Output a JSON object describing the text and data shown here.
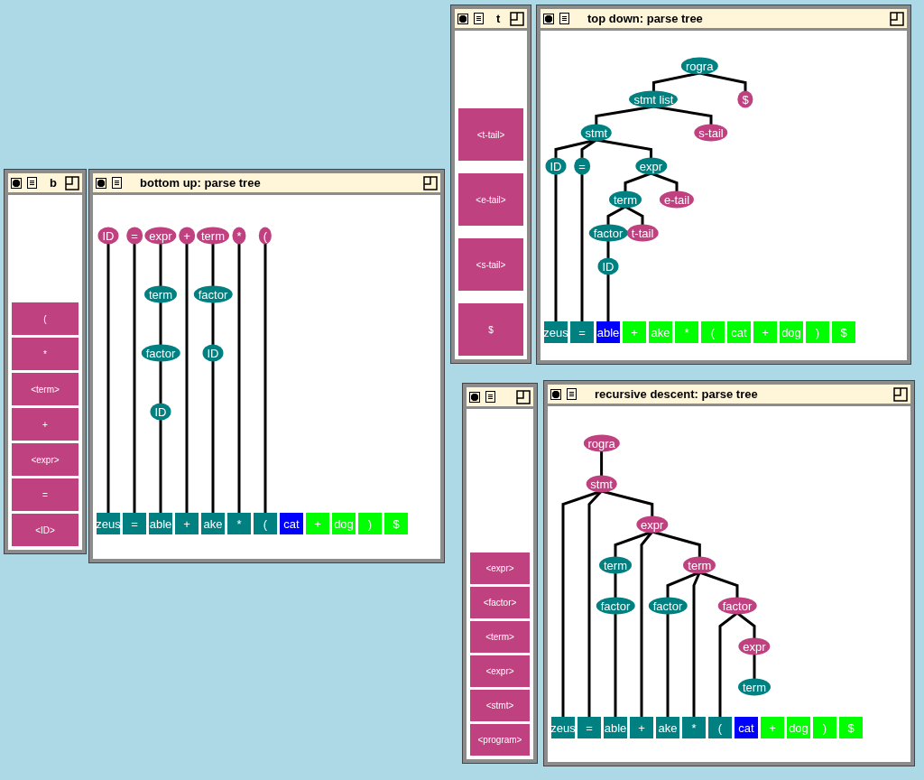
{
  "windows": [
    {
      "stack": {
        "title": "b",
        "items": [
          {
            "label": "("
          },
          {
            "label": "*"
          },
          {
            "label": "<term>"
          },
          {
            "label": "+"
          },
          {
            "label": "<expr>"
          },
          {
            "label": "="
          },
          {
            "label": "<ID>"
          }
        ]
      },
      "tree": {
        "title": "bottom up: parse tree",
        "roots": [
          {
            "kind": "node",
            "label": "ID",
            "color": "#c0417f",
            "children": [
              {
                "kind": "token"
              }
            ]
          },
          {
            "kind": "node",
            "label": "=",
            "color": "#c0417f",
            "children": [
              {
                "kind": "token"
              }
            ]
          },
          {
            "kind": "node",
            "label": "expr",
            "color": "#c0417f",
            "children": [
              {
                "kind": "node",
                "label": "term",
                "color": "#008080",
                "children": [
                  {
                    "kind": "node",
                    "label": "factor",
                    "color": "#008080",
                    "children": [
                      {
                        "kind": "node",
                        "label": "ID",
                        "color": "#008080",
                        "children": [
                          {
                            "kind": "token"
                          }
                        ]
                      }
                    ]
                  }
                ]
              }
            ]
          },
          {
            "kind": "node",
            "label": "+",
            "color": "#c0417f",
            "children": [
              {
                "kind": "token"
              }
            ]
          },
          {
            "kind": "node",
            "label": "term",
            "color": "#c0417f",
            "children": [
              {
                "kind": "node",
                "label": "factor",
                "color": "#008080",
                "children": [
                  {
                    "kind": "node",
                    "label": "ID",
                    "color": "#008080",
                    "children": [
                      {
                        "kind": "token"
                      }
                    ]
                  }
                ]
              }
            ]
          },
          {
            "kind": "node",
            "label": "*",
            "color": "#c0417f",
            "children": [
              {
                "kind": "token"
              }
            ]
          },
          {
            "kind": "node",
            "label": "(",
            "color": "#c0417f",
            "children": [
              {
                "kind": "token"
              }
            ]
          }
        ],
        "tokens": [
          {
            "label": "zeus",
            "color": "#008080"
          },
          {
            "label": "=",
            "color": "#008080"
          },
          {
            "label": "able",
            "color": "#008080"
          },
          {
            "label": "+",
            "color": "#008080"
          },
          {
            "label": "ake",
            "color": "#008080"
          },
          {
            "label": "*",
            "color": "#008080"
          },
          {
            "label": "(",
            "color": "#008080"
          },
          {
            "label": "cat",
            "color": "#0000ff"
          },
          {
            "label": "+",
            "color": "#00ff00"
          },
          {
            "label": "dog",
            "color": "#00ff00"
          },
          {
            "label": ")",
            "color": "#00ff00"
          },
          {
            "label": "$",
            "color": "#00ff00"
          }
        ]
      }
    },
    {
      "stack": {
        "title": "t",
        "items": [
          {
            "label": "<t-tail>"
          },
          {
            "label": "<e-tail>"
          },
          {
            "label": "<s-tail>"
          },
          {
            "label": "$"
          }
        ]
      },
      "tree": {
        "title": "top down: parse tree",
        "roots": [
          {
            "kind": "node",
            "label": "rogra",
            "color": "#008080",
            "children": [
              {
                "kind": "node",
                "label": "stmt list",
                "color": "#008080",
                "children": [
                  {
                    "kind": "node",
                    "label": "stmt",
                    "color": "#008080",
                    "children": [
                      {
                        "kind": "node",
                        "label": "ID",
                        "color": "#008080",
                        "children": [
                          {
                            "kind": "token"
                          }
                        ]
                      },
                      {
                        "kind": "node",
                        "label": "=",
                        "color": "#008080",
                        "children": [
                          {
                            "kind": "token"
                          }
                        ]
                      },
                      {
                        "kind": "node",
                        "label": "expr",
                        "color": "#008080",
                        "children": [
                          {
                            "kind": "node",
                            "label": "term",
                            "color": "#008080",
                            "children": [
                              {
                                "kind": "node",
                                "label": "factor",
                                "color": "#008080",
                                "children": [
                                  {
                                    "kind": "node",
                                    "label": "ID",
                                    "color": "#008080",
                                    "children": [
                                      {
                                        "kind": "token"
                                      }
                                    ]
                                  }
                                ]
                              },
                              {
                                "kind": "node",
                                "label": "t-tail",
                                "color": "#c0417f"
                              }
                            ]
                          },
                          {
                            "kind": "node",
                            "label": "e-tail",
                            "color": "#c0417f"
                          }
                        ]
                      }
                    ]
                  },
                  {
                    "kind": "node",
                    "label": "s-tail",
                    "color": "#c0417f"
                  }
                ]
              },
              {
                "kind": "node",
                "label": "$",
                "color": "#c0417f"
              }
            ]
          }
        ],
        "tokens": [
          {
            "label": "zeus",
            "color": "#008080"
          },
          {
            "label": "=",
            "color": "#008080"
          },
          {
            "label": "able",
            "color": "#0000ff"
          },
          {
            "label": "+",
            "color": "#00ff00"
          },
          {
            "label": "ake",
            "color": "#00ff00"
          },
          {
            "label": "*",
            "color": "#00ff00"
          },
          {
            "label": "(",
            "color": "#00ff00"
          },
          {
            "label": "cat",
            "color": "#00ff00"
          },
          {
            "label": "+",
            "color": "#00ff00"
          },
          {
            "label": "dog",
            "color": "#00ff00"
          },
          {
            "label": ")",
            "color": "#00ff00"
          },
          {
            "label": "$",
            "color": "#00ff00"
          }
        ]
      }
    },
    {
      "stack": {
        "items": [
          {
            "label": "<expr>"
          },
          {
            "label": "<factor>"
          },
          {
            "label": "<term>"
          },
          {
            "label": "<expr>"
          },
          {
            "label": "<stmt>"
          },
          {
            "label": "<program>"
          }
        ]
      },
      "tree": {
        "title": "recursive descent: parse tree",
        "roots": [
          {
            "kind": "node",
            "label": "rogra",
            "color": "#c0417f",
            "children": [
              {
                "kind": "node",
                "label": "stmt",
                "color": "#c0417f",
                "children": [
                  {
                    "kind": "token"
                  },
                  {
                    "kind": "token"
                  },
                  {
                    "kind": "node",
                    "label": "expr",
                    "color": "#c0417f",
                    "children": [
                      {
                        "kind": "node",
                        "label": "term",
                        "color": "#008080",
                        "children": [
                          {
                            "kind": "node",
                            "label": "factor",
                            "color": "#008080",
                            "children": [
                              {
                                "kind": "token"
                              }
                            ]
                          }
                        ]
                      },
                      {
                        "kind": "token"
                      },
                      {
                        "kind": "node",
                        "label": "term",
                        "color": "#c0417f",
                        "children": [
                          {
                            "kind": "node",
                            "label": "factor",
                            "color": "#008080",
                            "children": [
                              {
                                "kind": "token"
                              }
                            ]
                          },
                          {
                            "kind": "token"
                          },
                          {
                            "kind": "node",
                            "label": "factor",
                            "color": "#c0417f",
                            "children": [
                              {
                                "kind": "token"
                              },
                              {
                                "kind": "node",
                                "label": "expr",
                                "color": "#c0417f",
                                "children": [
                                  {
                                    "kind": "node",
                                    "label": "term",
                                    "color": "#008080"
                                  }
                                ]
                              }
                            ]
                          }
                        ]
                      }
                    ]
                  }
                ]
              }
            ]
          }
        ],
        "tokens": [
          {
            "label": "zeus",
            "color": "#008080"
          },
          {
            "label": "=",
            "color": "#008080"
          },
          {
            "label": "able",
            "color": "#008080"
          },
          {
            "label": "+",
            "color": "#008080"
          },
          {
            "label": "ake",
            "color": "#008080"
          },
          {
            "label": "*",
            "color": "#008080"
          },
          {
            "label": "(",
            "color": "#008080"
          },
          {
            "label": "cat",
            "color": "#0000ff"
          },
          {
            "label": "+",
            "color": "#00ff00"
          },
          {
            "label": "dog",
            "color": "#00ff00"
          },
          {
            "label": ")",
            "color": "#00ff00"
          },
          {
            "label": "$",
            "color": "#00ff00"
          }
        ]
      }
    }
  ]
}
